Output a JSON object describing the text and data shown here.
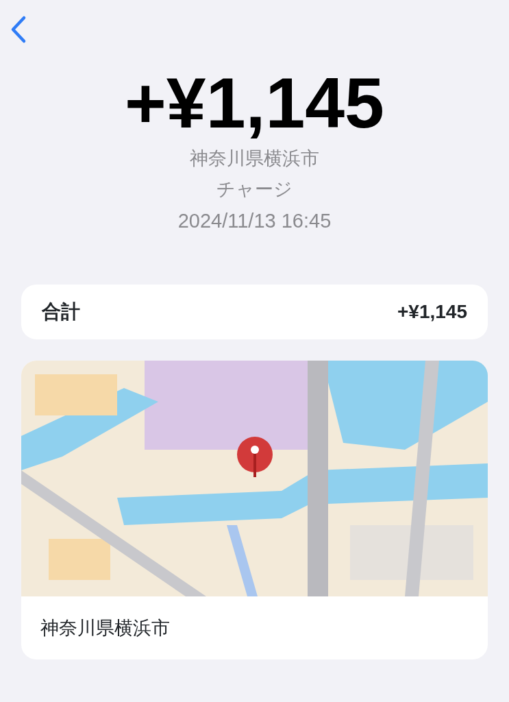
{
  "amount": "+¥1,145",
  "location": "神奈川県横浜市",
  "category": "チャージ",
  "datetime": "2024/11/13 16:45",
  "summary": {
    "label": "合計",
    "value": "+¥1,145"
  },
  "map_card": {
    "caption": "神奈川県横浜市"
  }
}
